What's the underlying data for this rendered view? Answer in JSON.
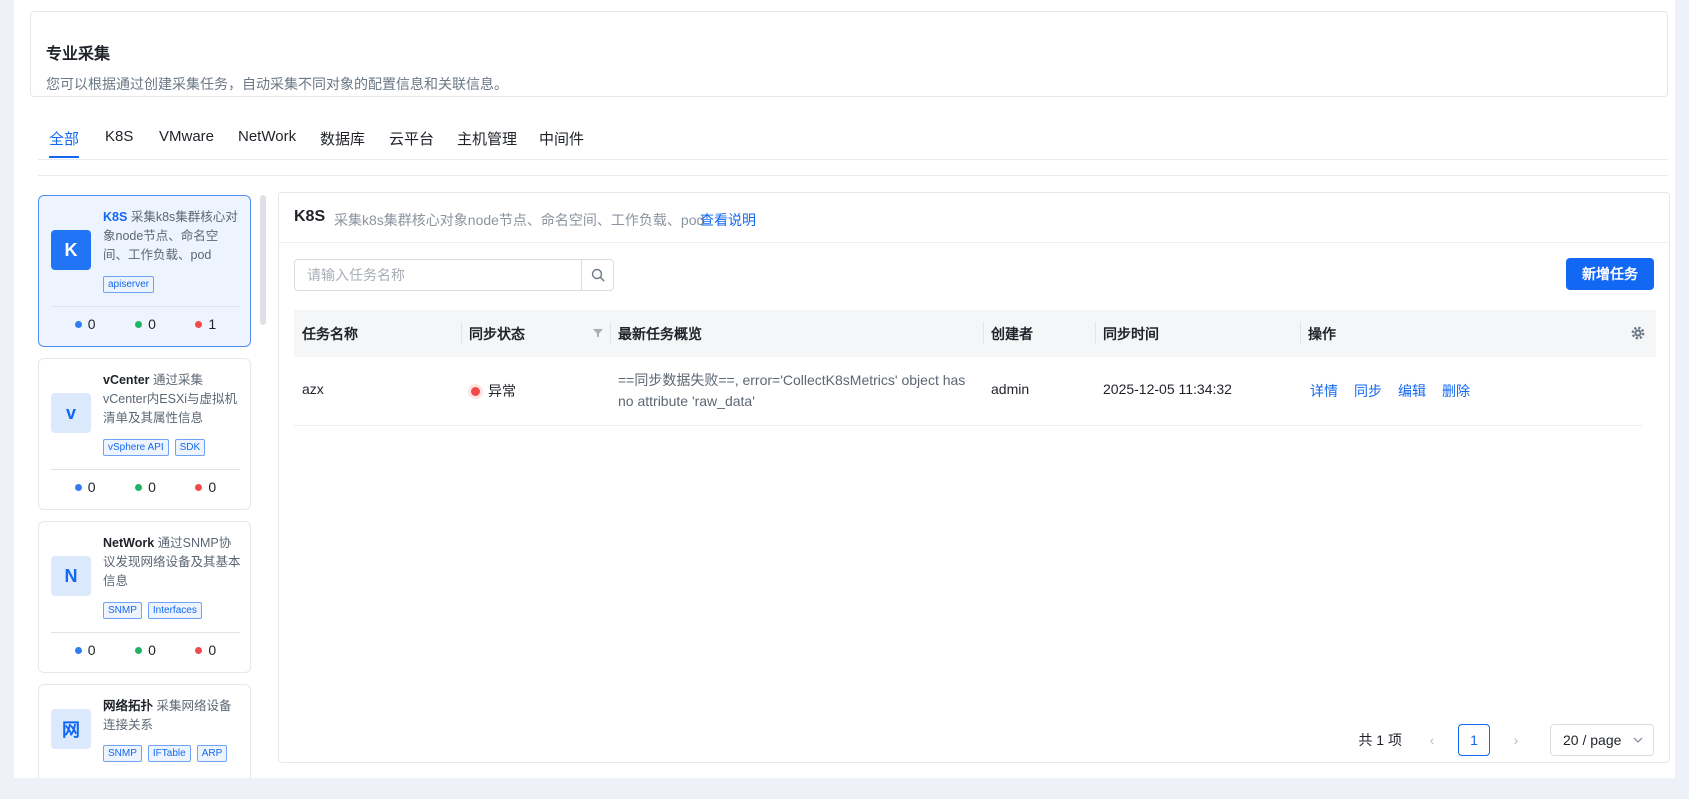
{
  "header": {
    "title": "专业采集",
    "description": "您可以根据通过创建采集任务，自动采集不同对象的配置信息和关联信息。"
  },
  "tabs": [
    "全部",
    "K8S",
    "VMware",
    "NetWork",
    "数据库",
    "云平台",
    "主机管理",
    "中间件"
  ],
  "active_tab": "全部",
  "collectors": [
    {
      "avatar": "K",
      "name": "K8S",
      "desc": "采集k8s集群核心对象node节点、命名空间、工作负载、pod",
      "tags": [
        "apiserver"
      ],
      "stats": [
        "0",
        "0",
        "1"
      ],
      "selected": true
    },
    {
      "avatar": "v",
      "name": "vCenter",
      "desc": "通过采集vCenter内ESXi与虚拟机清单及其属性信息",
      "tags": [
        "vSphere API",
        "SDK"
      ],
      "stats": [
        "0",
        "0",
        "0"
      ]
    },
    {
      "avatar": "N",
      "name": "NetWork",
      "desc": "通过SNMP协议发现网络设备及其基本信息",
      "tags": [
        "SNMP",
        "Interfaces"
      ],
      "stats": [
        "0",
        "0",
        "0"
      ]
    },
    {
      "avatar": "网",
      "name": "网络拓扑",
      "desc": "采集网络设备连接关系",
      "tags": [
        "SNMP",
        "IFTable",
        "ARP"
      ],
      "stats": []
    }
  ],
  "colors": {
    "accent": "#1268f3",
    "stat_blue": "#2e7ef2",
    "stat_green": "#1fb464",
    "stat_red": "#f04a4a"
  },
  "panel": {
    "title": "K8S",
    "subtitle": "采集k8s集群核心对象node节点、命名空间、工作负载、pod",
    "help_link": "查看说明",
    "search_placeholder": "请输入任务名称",
    "add_button": "新增任务"
  },
  "table": {
    "columns": [
      "任务名称",
      "同步状态",
      "最新任务概览",
      "创建者",
      "同步时间",
      "操作"
    ],
    "rows": [
      {
        "name": "azx",
        "status": "异常",
        "overview": "==同步数据失败==, error='CollectK8sMetrics' object has no attribute 'raw_data'",
        "creator": "admin",
        "sync_time": "2025-12-05 11:34:32",
        "actions": [
          "详情",
          "同步",
          "编辑",
          "删除"
        ]
      }
    ]
  },
  "pagination": {
    "total": "共 1 项",
    "current": "1",
    "page_size": "20 / page"
  }
}
